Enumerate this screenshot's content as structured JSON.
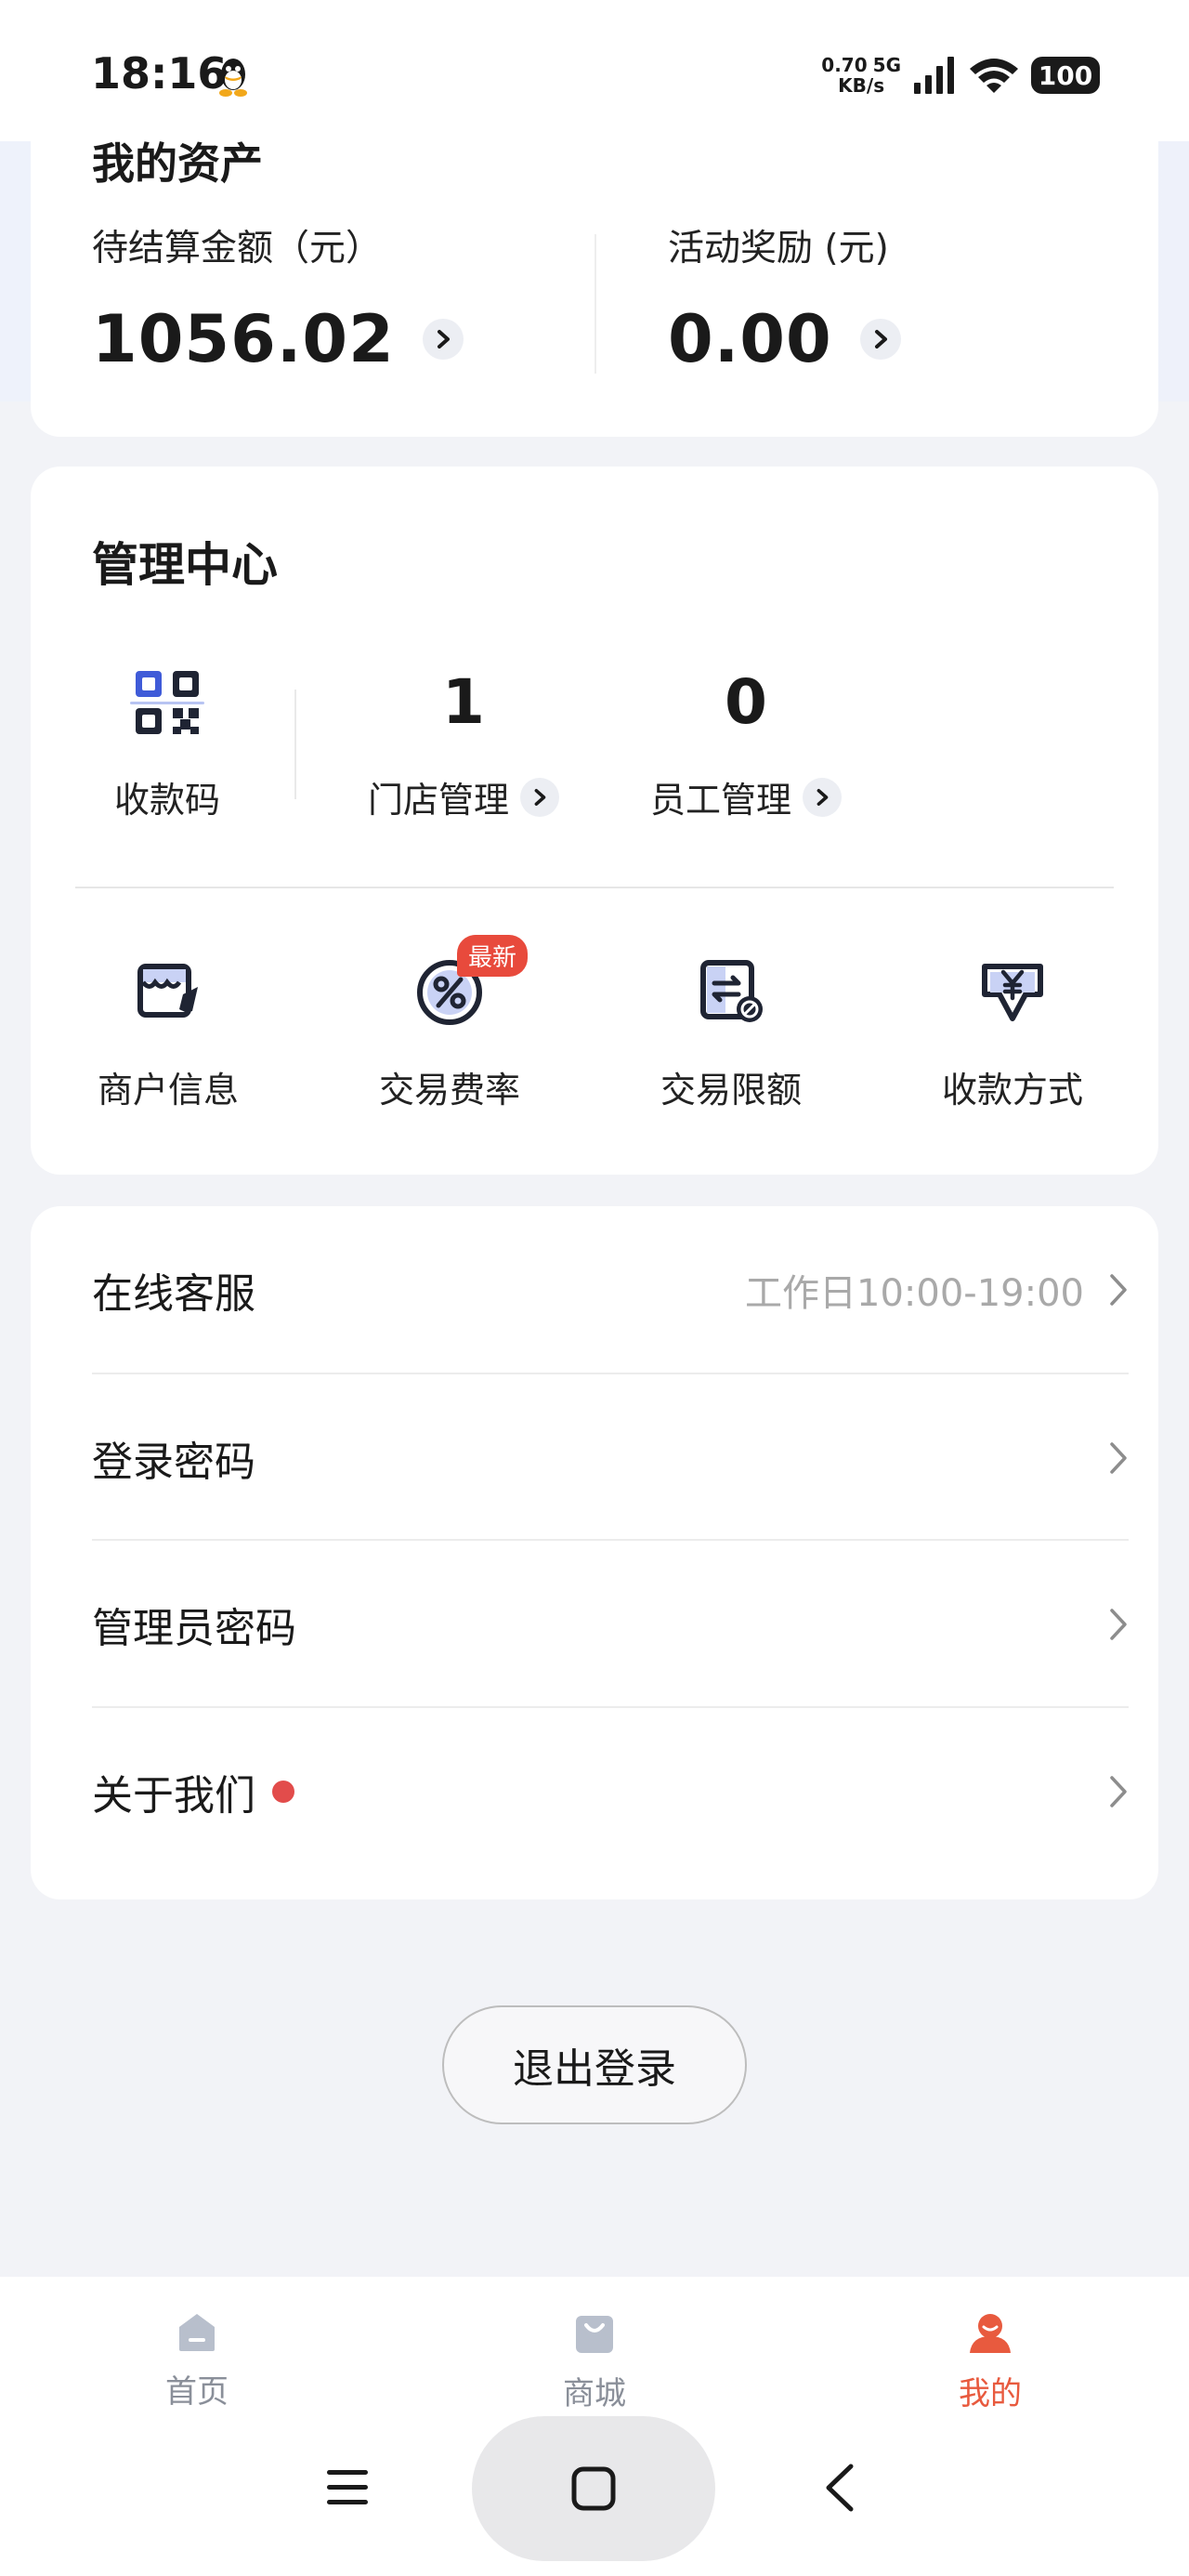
{
  "status_bar": {
    "time": "18:16",
    "net_speed": "0.70",
    "net_speed_unit": "KB/s",
    "network": "5G",
    "battery": "100"
  },
  "assets": {
    "title": "我的资产",
    "pending_label": "待结算金额（元）",
    "pending_value": "1056.02",
    "reward_label": "活动奖励 (元)",
    "reward_value": "0.00"
  },
  "management": {
    "title": "管理中心",
    "qr_label": "收款码",
    "store_count": "1",
    "store_label": "门店管理",
    "staff_count": "0",
    "staff_label": "员工管理",
    "tools": [
      {
        "label": "商户信息",
        "icon": "shop-edit-icon"
      },
      {
        "label": "交易费率",
        "icon": "percent-icon",
        "badge": "最新"
      },
      {
        "label": "交易限额",
        "icon": "limit-icon"
      },
      {
        "label": "收款方式",
        "icon": "yen-icon"
      }
    ]
  },
  "settings": {
    "items": [
      {
        "label": "在线客服",
        "hint": "工作日10:00-19:00"
      },
      {
        "label": "登录密码"
      },
      {
        "label": "管理员密码"
      },
      {
        "label": "关于我们"
      }
    ]
  },
  "logout_label": "退出登录",
  "tabs": [
    {
      "label": "首页",
      "icon": "home-icon"
    },
    {
      "label": "商城",
      "icon": "shop-bag-icon"
    },
    {
      "label": "我的",
      "icon": "user-icon",
      "active": true
    }
  ],
  "colors": {
    "accent": "#e85a3e",
    "badge": "#e84a3c",
    "icon_blue": "#3f5bd8",
    "tab_inactive": "#b8bfcc"
  }
}
